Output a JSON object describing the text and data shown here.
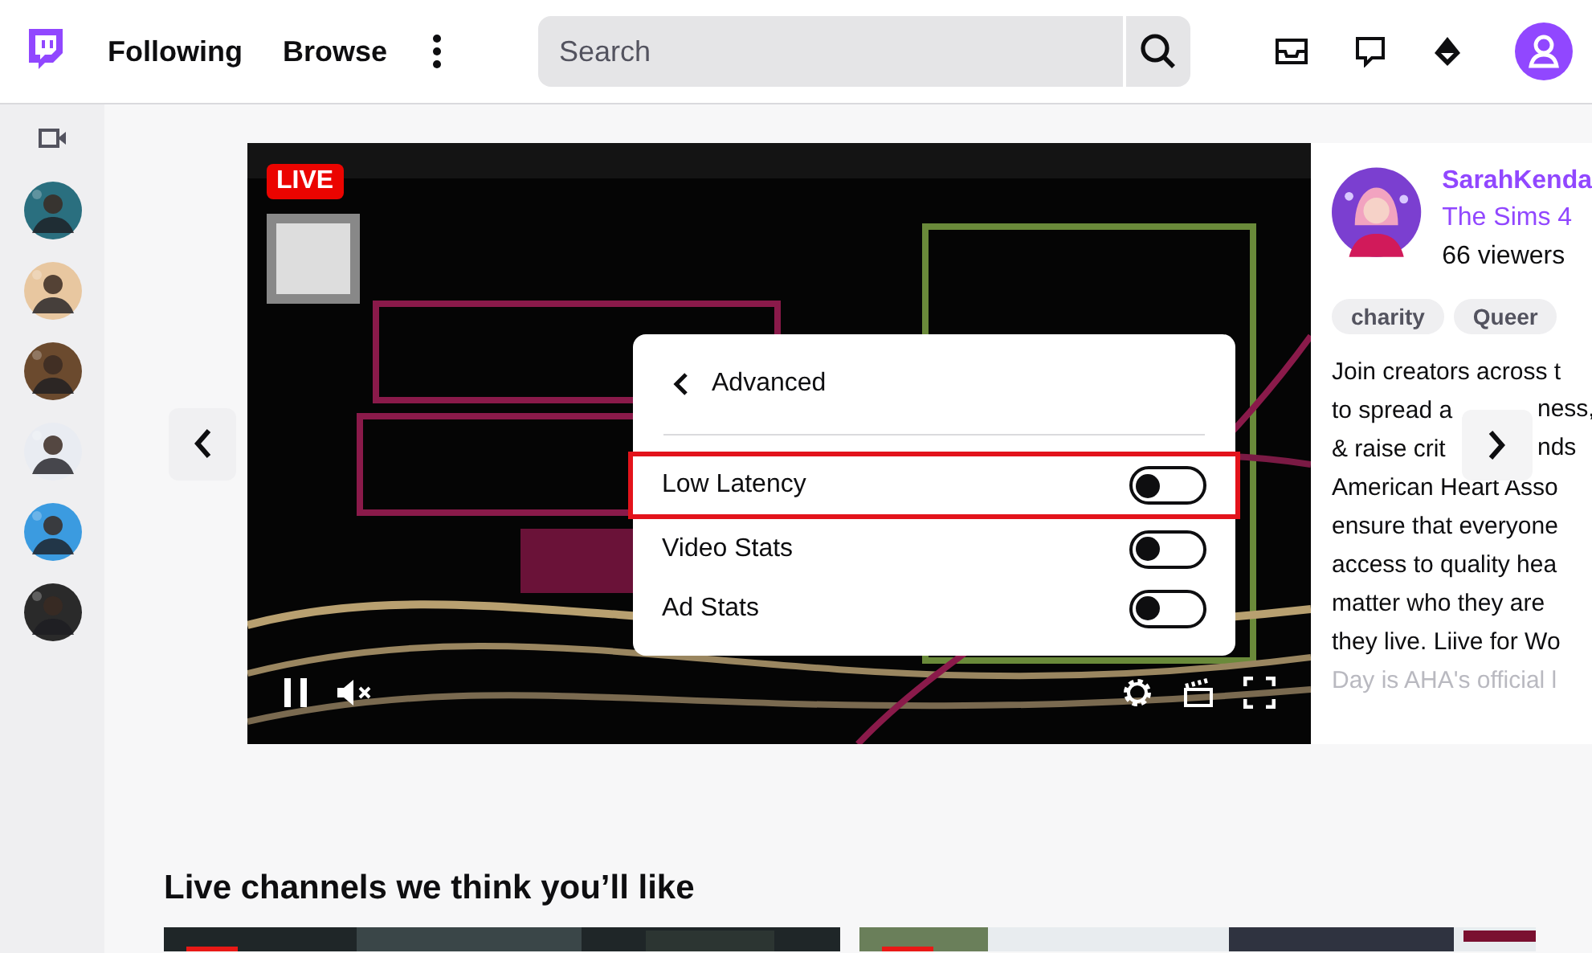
{
  "topbar": {
    "nav": [
      {
        "label": "Following"
      },
      {
        "label": "Browse"
      }
    ],
    "search": {
      "placeholder": "Search"
    }
  },
  "player": {
    "badge": "LIVE",
    "settings_menu": {
      "title": "Advanced",
      "options": [
        {
          "label": "Low Latency",
          "on": false,
          "highlighted": true
        },
        {
          "label": "Video Stats",
          "on": false,
          "highlighted": false
        },
        {
          "label": "Ad Stats",
          "on": false,
          "highlighted": false
        }
      ]
    }
  },
  "channel_info": {
    "name": "SarahKenda",
    "game": "The Sims 4",
    "viewers": "66 viewers",
    "tags": [
      "charity",
      "Queer"
    ],
    "description": [
      {
        "text": "Join creators across t",
        "faded": false
      },
      {
        "text": "to spread a",
        "rest": "ness,",
        "faded": false
      },
      {
        "text": "& raise crit",
        "rest": "nds",
        "faded": false
      },
      {
        "text": "American Heart Asso",
        "faded": false
      },
      {
        "text": "ensure that everyone",
        "faded": false
      },
      {
        "text": "access to quality hea",
        "faded": false
      },
      {
        "text": "matter who they are",
        "faded": false
      },
      {
        "text": "they live. Liive for Wo",
        "faded": false
      },
      {
        "text": "Day is AHA's official l",
        "faded": true
      }
    ]
  },
  "recommended": {
    "title": "Live channels we think you’ll like"
  }
}
